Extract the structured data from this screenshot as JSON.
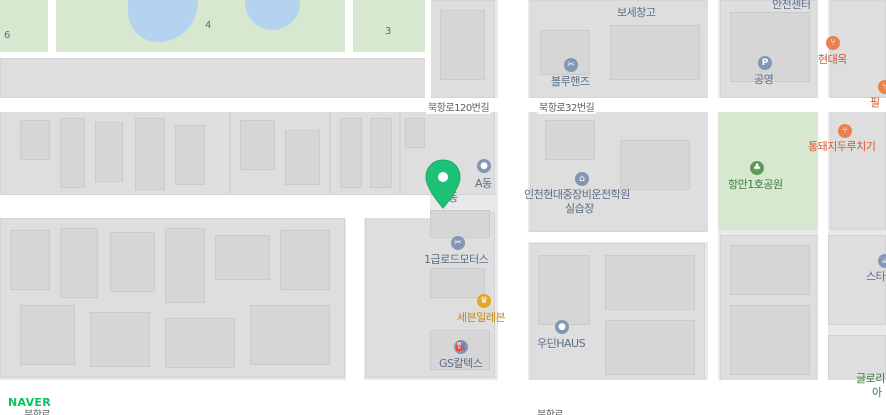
{
  "map": {
    "logo": "NAVER",
    "roads": [
      {
        "id": "road-1",
        "label": "북항로120번길"
      },
      {
        "id": "road-2",
        "label": "북항로32번길"
      },
      {
        "id": "road-3",
        "label": "북항로"
      },
      {
        "id": "road-4",
        "label": "북항로"
      }
    ],
    "pois": [
      {
        "id": "poi-bonded-warehouse",
        "label": "보세창고",
        "icon": "warehouse-icon"
      },
      {
        "id": "poi-center",
        "label": "안전센터",
        "icon": "building-icon"
      },
      {
        "id": "poi-bluehands",
        "label": "블루핸즈",
        "icon": "wrench-icon"
      },
      {
        "id": "poi-parking",
        "label": "공영",
        "icon": "parking-icon"
      },
      {
        "id": "poi-hyundaeok",
        "label": "현대옥",
        "icon": "restaurant-icon"
      },
      {
        "id": "poi-pil",
        "label": "필",
        "icon": "restaurant-icon"
      },
      {
        "id": "poi-a-dong",
        "label": "A동",
        "icon": "building-icon"
      },
      {
        "id": "poi-driving-school",
        "label": "인천현대중장비운전학원",
        "label2": "실습장",
        "icon": "school-icon"
      },
      {
        "id": "poi-pork",
        "label": "통돼지두루치기",
        "icon": "restaurant-icon"
      },
      {
        "id": "poi-park",
        "label": "항만1호공원",
        "icon": "park-icon"
      },
      {
        "id": "poi-motors",
        "label": "1급로드모터스",
        "icon": "wrench-icon"
      },
      {
        "id": "poi-starbucks",
        "label": "스타",
        "icon": "cafe-icon"
      },
      {
        "id": "poi-seven-eleven",
        "label": "세븐일레븐",
        "icon": "store-icon"
      },
      {
        "id": "poi-woodin",
        "label": "우딘HAUS",
        "icon": "building-icon"
      },
      {
        "id": "poi-gs-caltex",
        "label": "GS칼텍스",
        "icon": "gas-station-icon"
      },
      {
        "id": "poi-glory",
        "label": "글로리",
        "label2": "아",
        "icon": "building-icon"
      },
      {
        "id": "poi-dong",
        "label": "동",
        "icon": "building-icon"
      }
    ],
    "field_numbers": [
      "6",
      "4",
      "3"
    ],
    "marker": {
      "icon": "location-pin-icon",
      "color": "#1ec276"
    },
    "colors": {
      "park": "#d6e8cf",
      "water": "#b3d3ef",
      "road": "#ffffff",
      "poi": "#5a6e88",
      "restaurant": "#d3572f",
      "store": "#c48a14"
    }
  }
}
